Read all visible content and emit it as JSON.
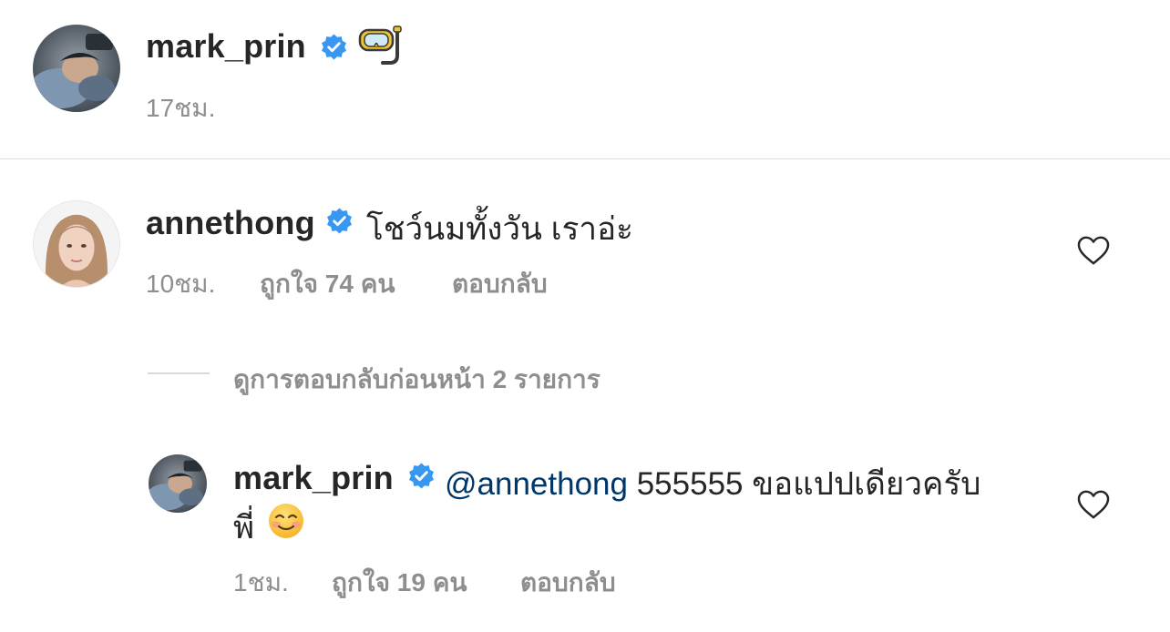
{
  "post": {
    "username": "mark_prin",
    "caption_icon": "diving-mask-icon",
    "time": "17ชม."
  },
  "comment": {
    "username": "annethong",
    "text": "โชว์นมทั้งวัน เราอ่ะ",
    "time": "10ชม.",
    "likes": "ถูกใจ 74 คน",
    "reply_label": "ตอบกลับ"
  },
  "view_replies": "ดูการตอบกลับก่อนหน้า 2 รายการ",
  "reply": {
    "username": "mark_prin",
    "mention": "@annethong",
    "text_line1": "555555 ขอแปปเดียวครับ",
    "text_line2": "พี่",
    "emoji_icon": "smiling-face-icon",
    "time": "1ชม.",
    "likes": "ถูกใจ 19 คน",
    "reply_label": "ตอบกลับ"
  },
  "colors": {
    "text": "#262626",
    "secondary": "#8e8e8e",
    "verified": "#3897f0",
    "mention": "#00376b",
    "divider": "#dbdbdb"
  }
}
